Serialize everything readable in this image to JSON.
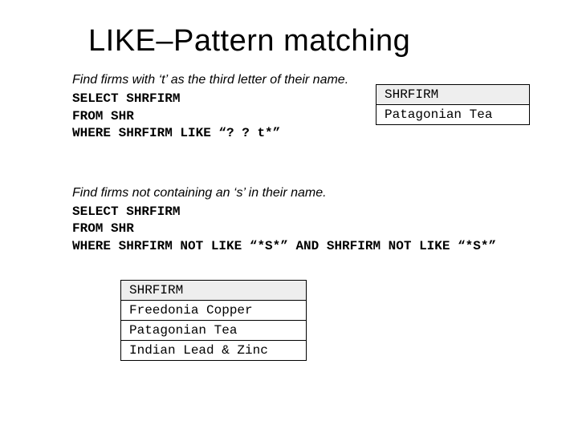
{
  "title": "LIKE–Pattern matching",
  "example1": {
    "prompt": "Find firms with ‘t’ as the third letter of their name.",
    "sql_line1": "SELECT SHRFIRM",
    "sql_line2": "FROM SHR",
    "sql_line3": "WHERE SHRFIRM LIKE “? ? t*”",
    "result_header": "SHRFIRM",
    "result_rows": [
      "Patagonian Tea"
    ]
  },
  "example2": {
    "prompt": "Find firms not containing an ‘s’ in their name.",
    "sql_line1": "SELECT SHRFIRM",
    "sql_line2": "FROM SHR",
    "sql_line3": "WHERE SHRFIRM NOT LIKE “*S*” AND SHRFIRM NOT LIKE “*S*”",
    "result_header": "SHRFIRM",
    "result_rows": [
      "Freedonia Copper",
      "Patagonian Tea",
      "Indian Lead & Zinc"
    ]
  }
}
